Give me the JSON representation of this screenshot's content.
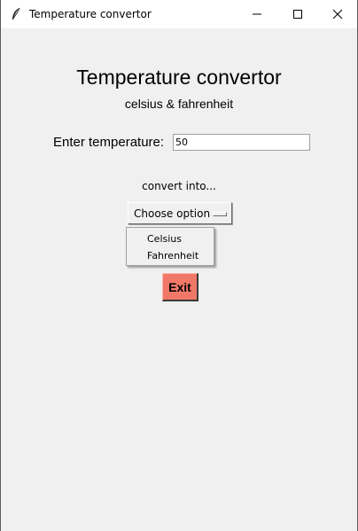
{
  "window": {
    "title": "Temperature convertor"
  },
  "icons": {
    "app": "feather-icon",
    "minimize": "minimize-icon",
    "maximize": "maximize-icon",
    "close": "close-icon"
  },
  "main": {
    "heading": "Temperature convertor",
    "subheading": "celsius & fahrenheit",
    "enter_label": "Enter temperature:",
    "temperature_value": "50",
    "convert_label": "convert into...",
    "option_menu": {
      "selected": "Choose option",
      "options": [
        "Celsius",
        "Fahrenheit"
      ]
    },
    "exit_label": "Exit"
  },
  "colors": {
    "exit_button": "#f17868",
    "background": "#f0f0f0"
  }
}
